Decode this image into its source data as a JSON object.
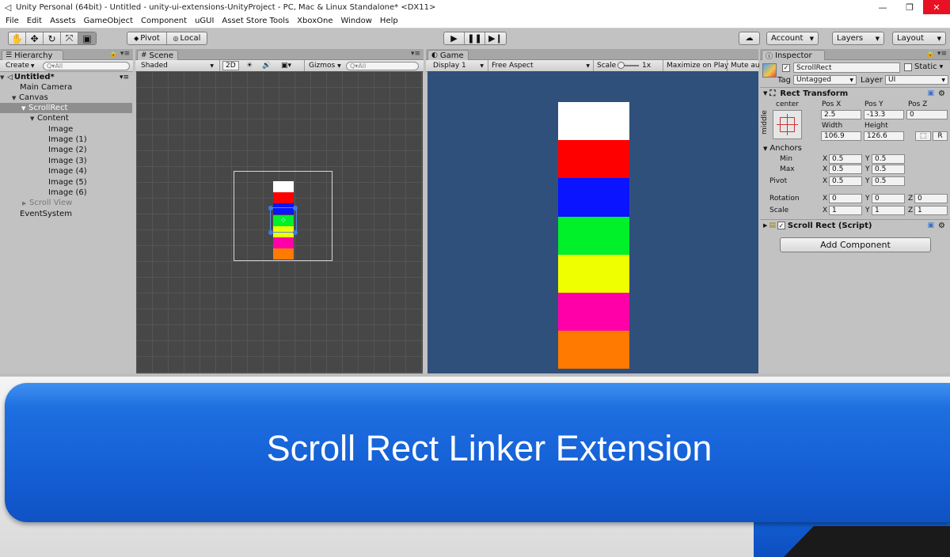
{
  "window": {
    "title": "Unity Personal (64bit) - Untitled - unity-ui-extensions-UnityProject - PC, Mac & Linux Standalone* <DX11>"
  },
  "menu": [
    "File",
    "Edit",
    "Assets",
    "GameObject",
    "Component",
    "uGUI",
    "Asset Store Tools",
    "XboxOne",
    "Window",
    "Help"
  ],
  "toolbar": {
    "pivot": "Pivot",
    "local": "Local",
    "account": "Account",
    "layers": "Layers",
    "layout": "Layout"
  },
  "hierarchy": {
    "tab": "Hierarchy",
    "create": "Create",
    "search_placeholder": "Q▾All",
    "scene_name": "Untitled*",
    "items": [
      {
        "label": "Main Camera"
      },
      {
        "label": "Canvas"
      },
      {
        "label": "ScrollRect"
      },
      {
        "label": "Content"
      },
      {
        "label": "Image"
      },
      {
        "label": "Image (1)"
      },
      {
        "label": "Image (2)"
      },
      {
        "label": "Image (3)"
      },
      {
        "label": "Image (4)"
      },
      {
        "label": "Image (5)"
      },
      {
        "label": "Image (6)"
      },
      {
        "label": "Scroll View"
      },
      {
        "label": "EventSystem"
      }
    ]
  },
  "scene": {
    "tab": "Scene",
    "shading": "Shaded",
    "mode2d": "2D",
    "gizmos": "Gizmos",
    "search_placeholder": "Q▾All"
  },
  "game": {
    "tab": "Game",
    "display": "Display 1",
    "aspect": "Free Aspect",
    "scale_label": "Scale",
    "scale_value": "1x",
    "maximize": "Maximize on Play",
    "mute": "Mute au"
  },
  "blocks": {
    "colors": [
      "#ffffff",
      "#ff0000",
      "#0a14ff",
      "#00f02a",
      "#f0ff00",
      "#ff00a8",
      "#ff7a00"
    ]
  },
  "inspector": {
    "tab": "Inspector",
    "object_name": "ScrollRect",
    "static_label": "Static",
    "tag_label": "Tag",
    "tag_value": "Untagged",
    "layer_label": "Layer",
    "layer_value": "UI",
    "rect_transform": "Rect Transform",
    "anchor_h": "center",
    "anchor_v": "middle",
    "pos_x_label": "Pos X",
    "pos_y_label": "Pos Y",
    "pos_z_label": "Pos Z",
    "pos_x": "2.5",
    "pos_y": "-13.3",
    "pos_z": "0",
    "width_label": "Width",
    "height_label": "Height",
    "width": "106.9",
    "height": "126.6",
    "r_button": "R",
    "anchors_label": "Anchors",
    "min_label": "Min",
    "max_label": "Max",
    "pivot_label": "Pivot",
    "x_label": "X",
    "y_label": "Y",
    "z_label": "Z",
    "anchor_min_x": "0.5",
    "anchor_min_y": "0.5",
    "anchor_max_x": "0.5",
    "anchor_max_y": "0.5",
    "pivot_x": "0.5",
    "pivot_y": "0.5",
    "rotation_label": "Rotation",
    "rot_x": "0",
    "rot_y": "0",
    "rot_z": "0",
    "scale_label": "Scale",
    "scale_x": "1",
    "scale_y": "1",
    "scale_z": "1",
    "script_component": "Scroll Rect (Script)",
    "add_component": "Add Component"
  },
  "banner": {
    "text": "Scroll Rect Linker Extension"
  }
}
